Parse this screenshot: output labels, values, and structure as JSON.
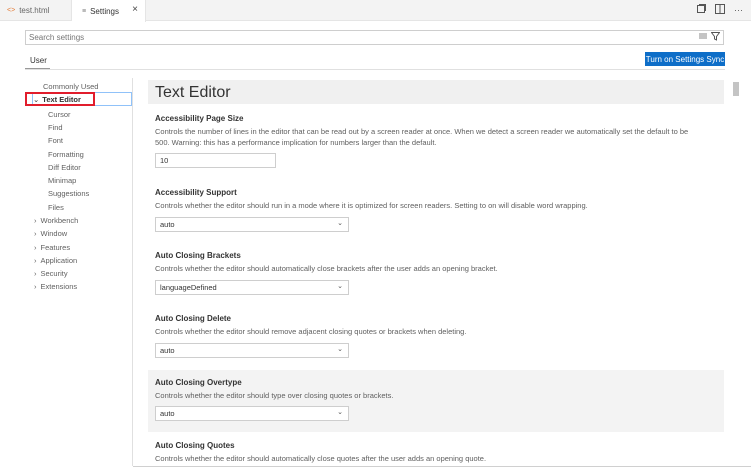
{
  "tabs": [
    {
      "label": "test.html",
      "icon": "html-file-icon"
    },
    {
      "label": "Settings",
      "icon": "settings-file-icon"
    }
  ],
  "search": {
    "placeholder": "Search settings"
  },
  "scope": {
    "user_label": "User"
  },
  "sync_button": "Turn on Settings Sync",
  "toc": {
    "commonly_used": "Commonly Used",
    "text_editor": "Text Editor",
    "children": [
      "Cursor",
      "Find",
      "Font",
      "Formatting",
      "Diff Editor",
      "Minimap",
      "Suggestions",
      "Files"
    ],
    "groups": [
      "Workbench",
      "Window",
      "Features",
      "Application",
      "Security",
      "Extensions"
    ]
  },
  "section_title": "Text Editor",
  "settings": [
    {
      "title": "Accessibility Page Size",
      "desc1": "Controls the number of lines in the editor that can be read out by a screen reader at once. When we detect a screen reader we automatically set the default to be",
      "desc2": "500. Warning: this has a performance implication for numbers larger than the default.",
      "value": "10"
    },
    {
      "title": "Accessibility Support",
      "desc1": "Controls whether the editor should run in a mode where it is optimized for screen readers. Setting to on will disable word wrapping.",
      "value": "auto"
    },
    {
      "title": "Auto Closing Brackets",
      "desc1": "Controls whether the editor should automatically close brackets after the user adds an opening bracket.",
      "value": "languageDefined"
    },
    {
      "title": "Auto Closing Delete",
      "desc1": "Controls whether the editor should remove adjacent closing quotes or brackets when deleting.",
      "value": "auto"
    },
    {
      "title": "Auto Closing Overtype",
      "desc1": "Controls whether the editor should type over closing quotes or brackets.",
      "value": "auto"
    },
    {
      "title": "Auto Closing Quotes",
      "desc1": "Controls whether the editor should automatically close quotes after the user adds an opening quote."
    }
  ],
  "colors": {
    "accent": "#0e6ec8",
    "highlight_box": "#e11d2c",
    "selection_border": "#90c2f9"
  }
}
